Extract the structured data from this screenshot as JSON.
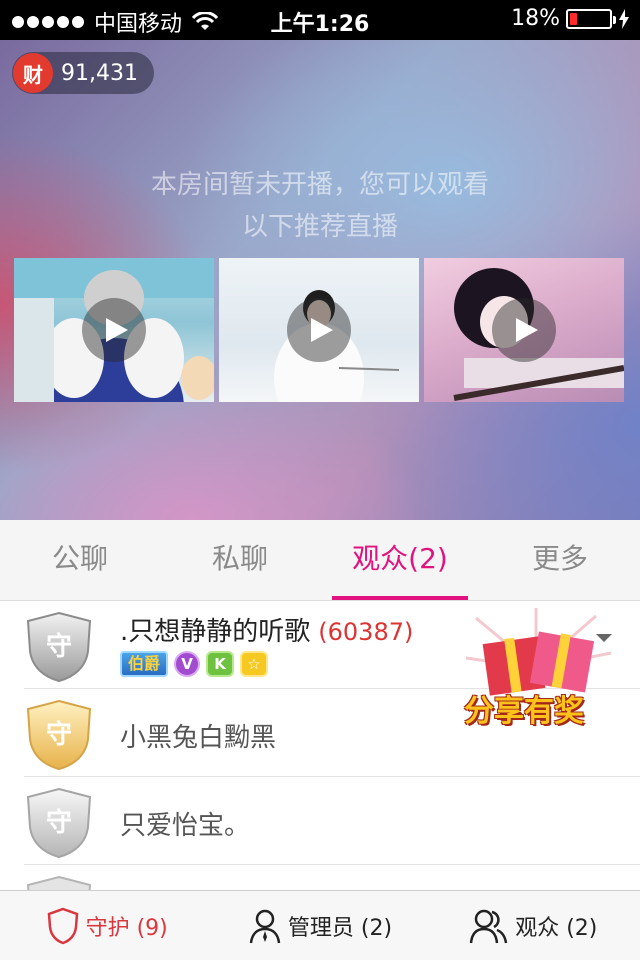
{
  "status_bar": {
    "carrier": "中国移动",
    "time": "上午1:26",
    "battery": "18%",
    "battery_level": 0.18
  },
  "hero": {
    "wealth_badge": "财",
    "wealth_value": "91,431",
    "notice_line1": "本房间暂未开播，您可以观看",
    "notice_line2": "以下推荐直播"
  },
  "tabs": [
    {
      "label": "公聊"
    },
    {
      "label": "私聊"
    },
    {
      "label": "观众(2)"
    },
    {
      "label": "更多"
    }
  ],
  "list": {
    "shield_char": "守",
    "items": [
      {
        "name": ".只想静静的听歌",
        "score": "(60387)",
        "rank_medal": "伯爵",
        "badge_v": "V",
        "badge_k": "K",
        "badge_star": "☆"
      },
      {
        "name": "小黑兔白黝黑"
      },
      {
        "name": "只爱怡宝。"
      }
    ]
  },
  "gift_banner": {
    "text": "分享有奖"
  },
  "bottom_bar": {
    "guard": "守护 (9)",
    "admins": "管理员 (2)",
    "audience": "观众 (2)"
  },
  "colors": {
    "accent": "#e2127e",
    "guard_red": "#d9373f",
    "score_red": "#dd3333"
  }
}
